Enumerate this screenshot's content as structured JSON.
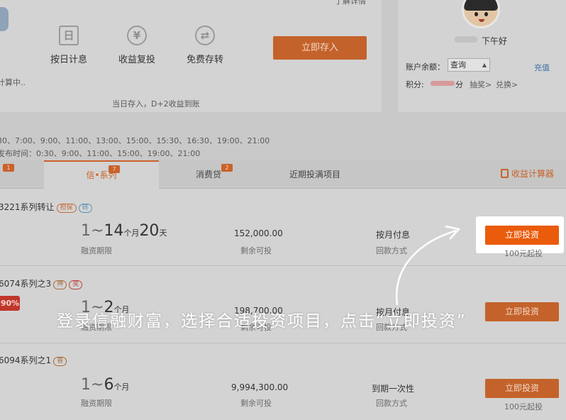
{
  "header": {
    "top_right_text": "了解详情",
    "features": [
      {
        "icon": "calendar-icon",
        "glyph": "日",
        "label": "按日计息"
      },
      {
        "icon": "yen-compound-icon",
        "glyph": "¥",
        "label": "收益复投"
      },
      {
        "icon": "transfer-icon",
        "glyph": "⇄",
        "label": "免费存转"
      }
    ],
    "deposit_button": "立即存入",
    "calculating_text": "计算中..",
    "settlement_note": "当日存入，D+2收益到账"
  },
  "account": {
    "greeting": "下午好",
    "balance_label": "账户余额：",
    "balance_select": "查询",
    "recharge_link": "充值",
    "points_label": "积分:",
    "points_unit": "分",
    "lottery_link": "抽奖>",
    "redeem_link": "兑换>"
  },
  "schedule": {
    "line1": "30、7:00、9:00、11:00、13:00、15:00、15:30、16:30、19:00、21:00",
    "line2": "发布时间：0:30、9:00、11:00、15:00、19:00、21:00"
  },
  "tabs": [
    {
      "label": "",
      "badge": "1"
    },
    {
      "label": "信•系列",
      "badge": "7",
      "active": true
    },
    {
      "label": "消费贷",
      "badge": "2"
    },
    {
      "label": "近期投满项目",
      "badge": ""
    }
  ],
  "calculator_link": "收益计算器",
  "products": [
    {
      "title": "3221系列转让",
      "tags": [
        "担保",
        "转"
      ],
      "term_from": "1",
      "term_to": "14",
      "term_unit": "个月",
      "term_extra": "20",
      "term_extra_unit": "天",
      "term_label": "融资期限",
      "amount": "152,000.00",
      "amount_label": "剩余可投",
      "repay": "按月付息",
      "repay_label": "回款方式",
      "button": "立即投资",
      "min_invest": "100元起投"
    },
    {
      "title": "6074系列之3",
      "tags": [
        "押",
        "奖"
      ],
      "rate_badge": "90%",
      "term_from": "1",
      "term_to": "2",
      "term_unit": "个月",
      "term_label": "融资期限",
      "amount": "198,700.00",
      "amount_label": "剩余可投",
      "repay": "按月付息",
      "repay_label": "回款方式",
      "button": "立即投资"
    },
    {
      "title": "6094系列之1",
      "tags": [
        "普"
      ],
      "term_from": "1",
      "term_to": "6",
      "term_unit": "个月",
      "term_label": "融资期限",
      "amount": "9,994,300.00",
      "amount_label": "剩余可投",
      "repay": "到期一次性",
      "repay_label": "回款方式",
      "button": "立即投资",
      "min_invest": "100元起投"
    }
  ],
  "caption": "登录信融财富，选择合适投资项目，点击“立即投资”",
  "colors": {
    "accent": "#ea5b0b",
    "accent_dimmed": "#c4622b",
    "overlay_text": "#ffffff"
  }
}
